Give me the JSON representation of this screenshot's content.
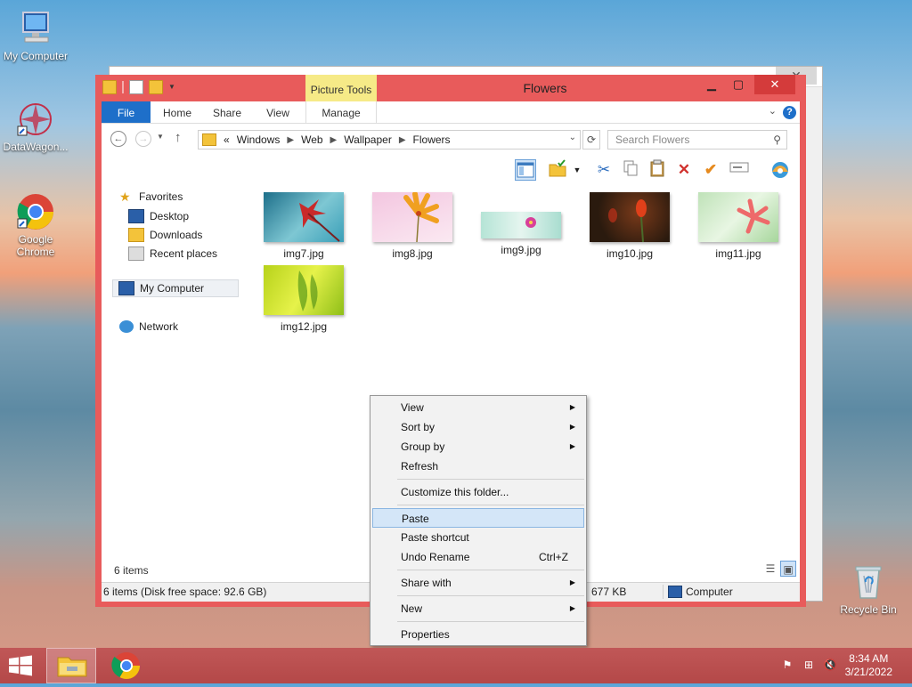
{
  "desktop": {
    "icons": [
      {
        "label": "My Computer"
      },
      {
        "label": "DataWagon..."
      },
      {
        "label": "Google Chrome"
      },
      {
        "label": "Recycle Bin"
      }
    ]
  },
  "window": {
    "title": "Flowers",
    "contextual_tab_group": "Picture Tools",
    "tabs": [
      "File",
      "Home",
      "Share",
      "View",
      "Manage"
    ],
    "address": {
      "overflow": "«",
      "crumbs": [
        "Windows",
        "Web",
        "Wallpaper",
        "Flowers"
      ]
    },
    "search_placeholder": "Search Flowers",
    "nav": {
      "favorites": "Favorites",
      "desktop": "Desktop",
      "downloads": "Downloads",
      "recent": "Recent places",
      "computer": "My Computer",
      "network": "Network"
    },
    "files": [
      {
        "name": "img7.jpg"
      },
      {
        "name": "img8.jpg"
      },
      {
        "name": "img9.jpg"
      },
      {
        "name": "img10.jpg"
      },
      {
        "name": "img11.jpg"
      },
      {
        "name": "img12.jpg"
      }
    ],
    "item_count": "6 items",
    "status": {
      "left": "6 items (Disk free space: 92.6 GB)",
      "size": "677 KB",
      "location": "Computer"
    }
  },
  "context_menu": {
    "view": "View",
    "sort_by": "Sort by",
    "group_by": "Group by",
    "refresh": "Refresh",
    "customize": "Customize this folder...",
    "paste": "Paste",
    "paste_shortcut": "Paste shortcut",
    "undo_rename": "Undo Rename",
    "undo_accel": "Ctrl+Z",
    "share_with": "Share with",
    "new": "New",
    "properties": "Properties"
  },
  "taskbar": {
    "time": "8:34 AM",
    "date": "3/21/2022"
  }
}
